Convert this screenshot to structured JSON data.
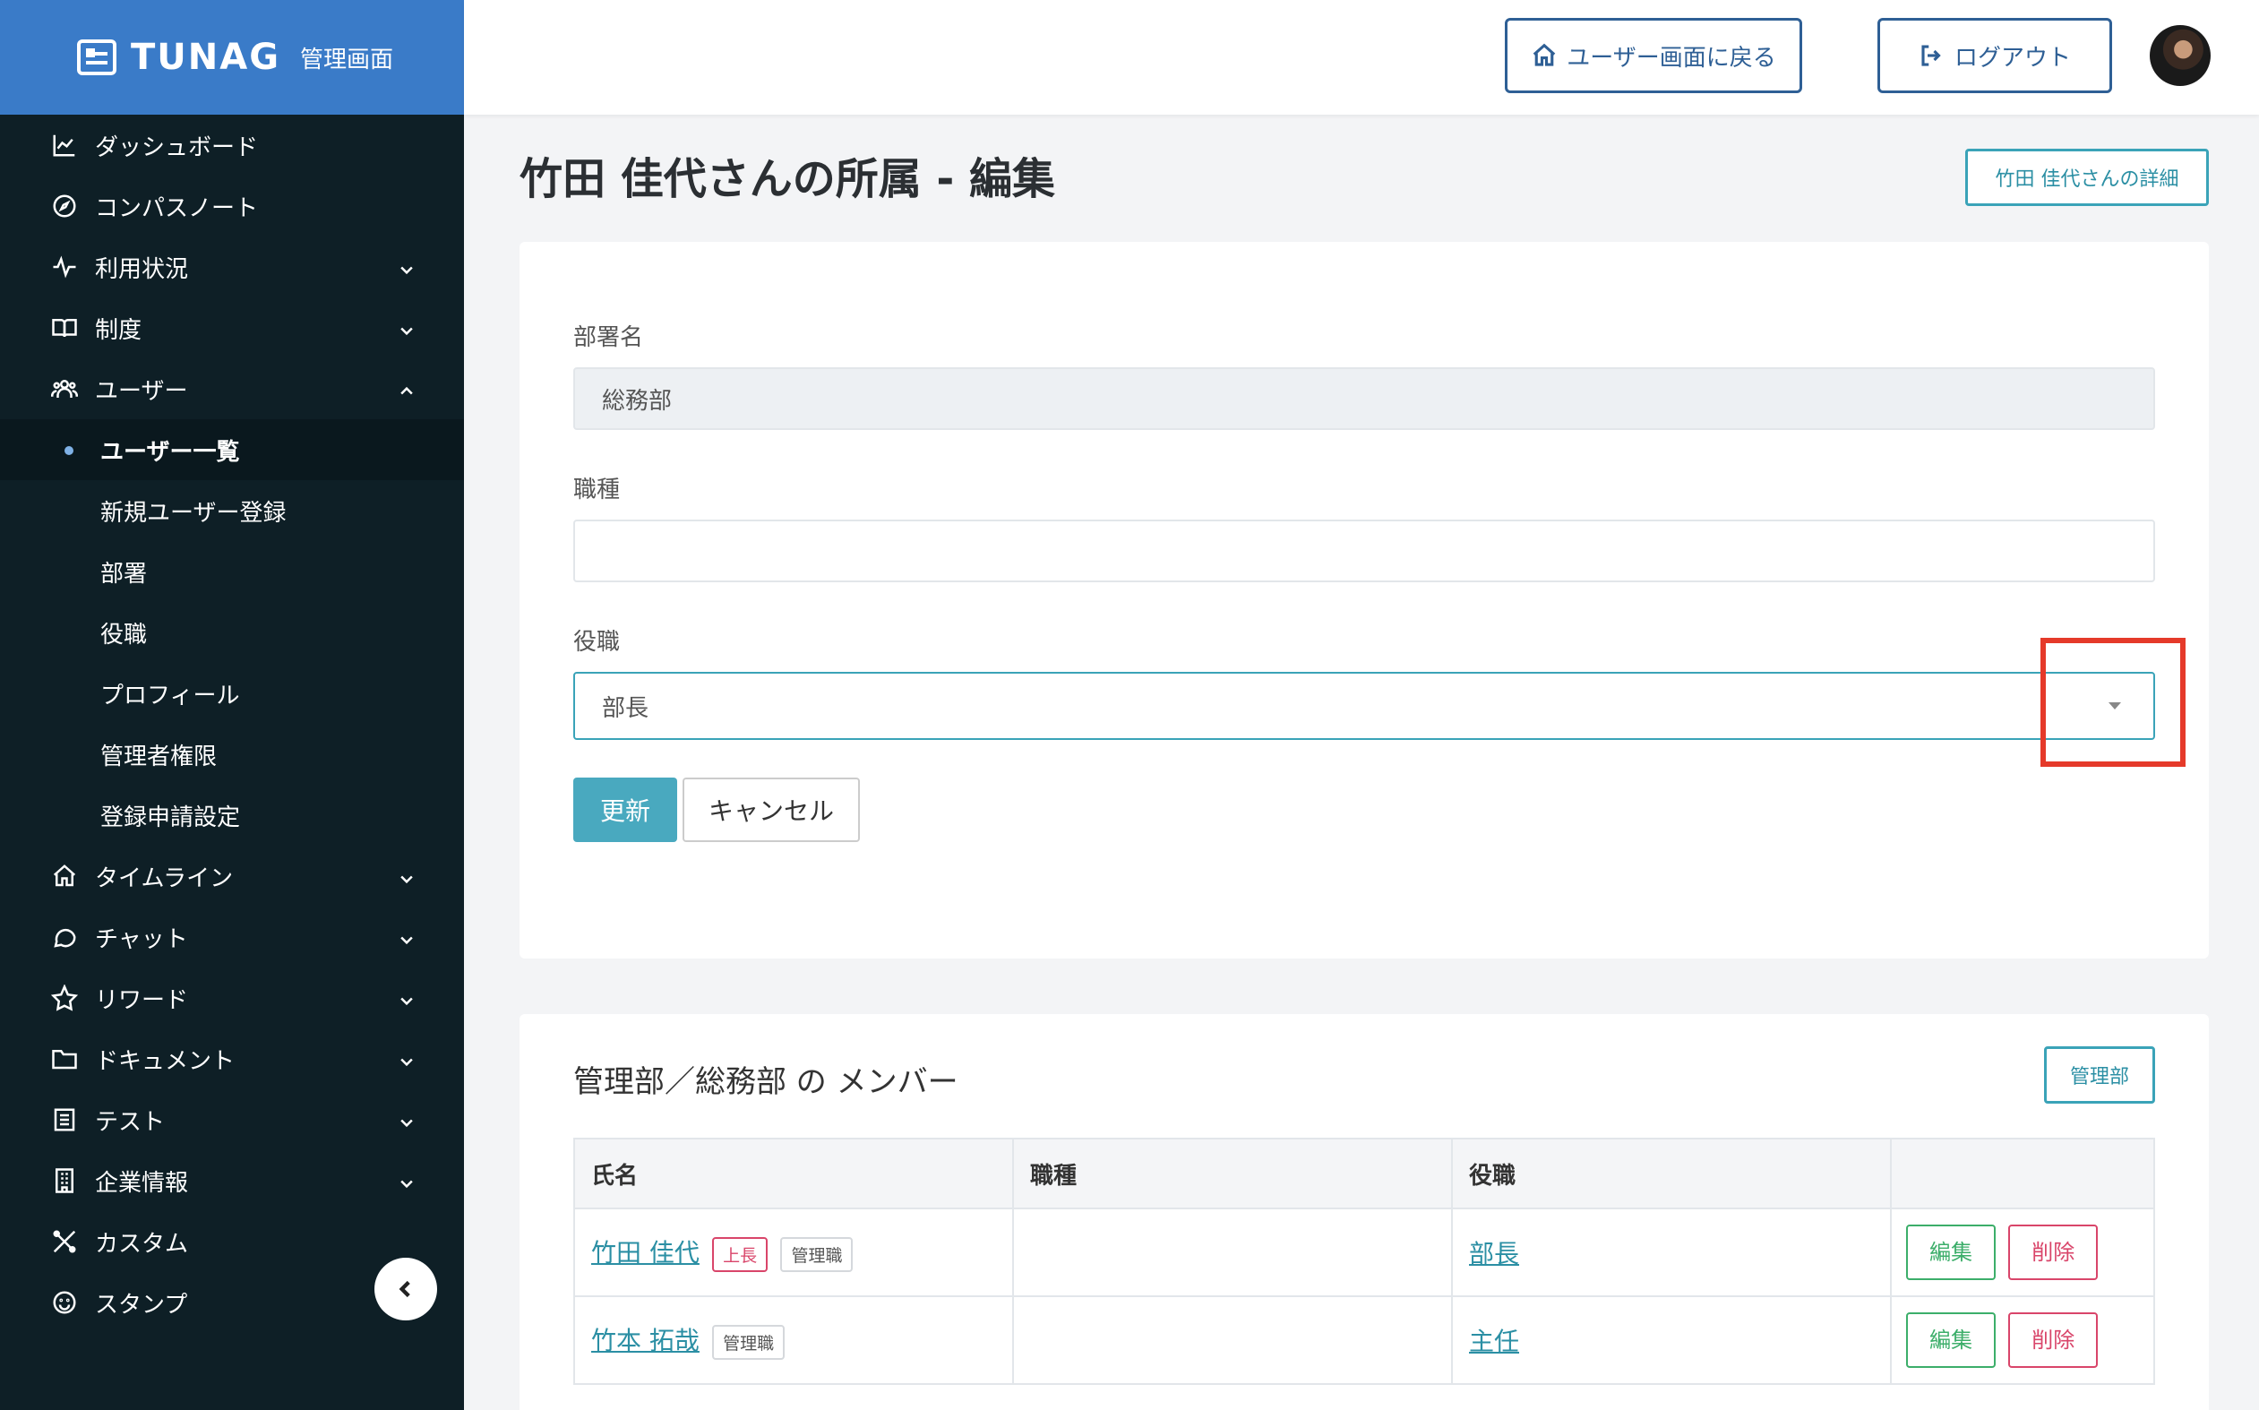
{
  "brand": {
    "name": "TUNAG",
    "subtitle": "管理画面"
  },
  "sidebar": {
    "items": [
      {
        "label": "ダッシュボード",
        "icon": "chart-line-icon"
      },
      {
        "label": "コンパスノート",
        "icon": "compass-icon"
      },
      {
        "label": "利用状況",
        "icon": "activity-icon",
        "expandable": true
      },
      {
        "label": "制度",
        "icon": "book-icon",
        "expandable": true
      },
      {
        "label": "ユーザー",
        "icon": "users-icon",
        "expanded": true
      }
    ],
    "user_sub": [
      {
        "label": "ユーザー一覧",
        "active": true
      },
      {
        "label": "新規ユーザー登録"
      },
      {
        "label": "部署"
      },
      {
        "label": "役職"
      },
      {
        "label": "プロフィール"
      },
      {
        "label": "管理者権限"
      },
      {
        "label": "登録申請設定"
      }
    ],
    "items_after": [
      {
        "label": "タイムライン",
        "icon": "home-icon"
      },
      {
        "label": "チャット",
        "icon": "chat-icon"
      },
      {
        "label": "リワード",
        "icon": "star-icon"
      },
      {
        "label": "ドキュメント",
        "icon": "folder-icon"
      },
      {
        "label": "テスト",
        "icon": "list-icon"
      },
      {
        "label": "企業情報",
        "icon": "building-icon"
      },
      {
        "label": "カスタム",
        "icon": "tools-icon"
      },
      {
        "label": "スタンプ",
        "icon": "smile-icon"
      }
    ]
  },
  "header": {
    "back_label": "ユーザー画面に戻る",
    "logout_label": "ログアウト"
  },
  "page": {
    "title": "竹田 佳代さんの所属 - 編集",
    "detail_button": "竹田 佳代さんの詳細"
  },
  "form": {
    "dept_label": "部署名",
    "dept_value": "総務部",
    "job_label": "職種",
    "job_value": "",
    "position_label": "役職",
    "position_value": "部長",
    "submit_label": "更新",
    "cancel_label": "キャンセル"
  },
  "members": {
    "title": "管理部／総務部 の メンバー",
    "dept_button": "管理部",
    "columns": [
      "氏名",
      "職種",
      "役職",
      ""
    ],
    "rows": [
      {
        "name": "竹田 佳代",
        "badges": [
          "上長",
          "管理職"
        ],
        "job": "",
        "position": "部長"
      },
      {
        "name": "竹本 拓哉",
        "badges": [
          "管理職"
        ],
        "job": "",
        "position": "主任"
      }
    ],
    "edit_label": "編集",
    "delete_label": "削除"
  }
}
